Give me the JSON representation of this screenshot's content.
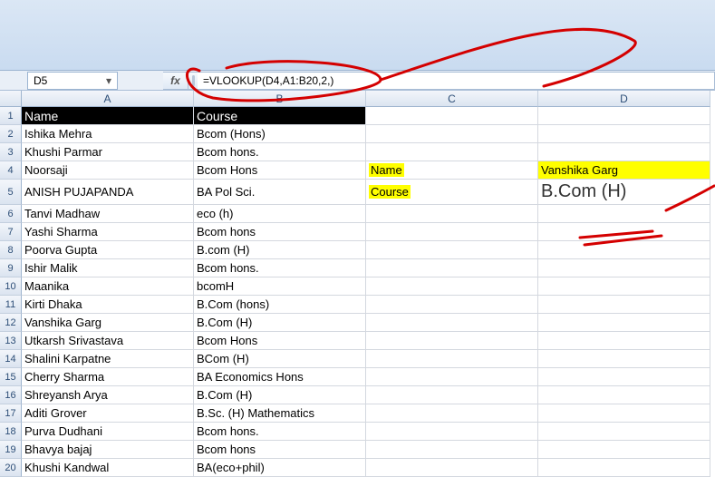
{
  "name_box": "D5",
  "fx_label": "fx",
  "formula": "=VLOOKUP(D4,A1:B20,2,)",
  "col_headers": [
    "A",
    "B",
    "C",
    "D"
  ],
  "row_numbers": [
    "1",
    "2",
    "3",
    "4",
    "5",
    "6",
    "7",
    "8",
    "9",
    "10",
    "11",
    "12",
    "13",
    "14",
    "15",
    "16",
    "17",
    "18",
    "19",
    "20"
  ],
  "header": {
    "a": "Name",
    "b": "Course"
  },
  "side": {
    "name_label": "Name",
    "name_value": "Vanshika Garg",
    "course_label": "Course",
    "course_value": "B.Com (H)"
  },
  "rows": [
    {
      "a": "Ishika Mehra",
      "b": "Bcom (Hons)"
    },
    {
      "a": "Khushi Parmar",
      "b": "Bcom hons."
    },
    {
      "a": "Noorsaji",
      "b": "Bcom Hons"
    },
    {
      "a": "ANISH PUJAPANDA",
      "b": "BA Pol Sci."
    },
    {
      "a": "Tanvi Madhaw",
      "b": "eco (h)"
    },
    {
      "a": "Yashi Sharma",
      "b": "Bcom hons"
    },
    {
      "a": "Poorva Gupta",
      "b": "B.com (H)"
    },
    {
      "a": "Ishir Malik",
      "b": "Bcom hons."
    },
    {
      "a": "Maanika",
      "b": "bcomH"
    },
    {
      "a": "Kirti Dhaka",
      "b": "B.Com (hons)"
    },
    {
      "a": "Vanshika Garg",
      "b": "B.Com (H)"
    },
    {
      "a": "Utkarsh Srivastava",
      "b": "Bcom Hons"
    },
    {
      "a": "Shalini Karpatne",
      "b": "BCom (H)"
    },
    {
      "a": "Cherry Sharma",
      "b": "BA Economics Hons"
    },
    {
      "a": "Shreyansh Arya",
      "b": "B.Com (H)"
    },
    {
      "a": "Aditi Grover",
      "b": "B.Sc. (H) Mathematics"
    },
    {
      "a": "Purva Dudhani",
      "b": "Bcom hons."
    },
    {
      "a": "Bhavya bajaj",
      "b": "Bcom hons"
    },
    {
      "a": "Khushi Kandwal",
      "b": "BA(eco+phil)"
    }
  ],
  "chart_data": {
    "type": "table",
    "columns": [
      "Name",
      "Course"
    ],
    "rows": [
      [
        "Ishika Mehra",
        "Bcom (Hons)"
      ],
      [
        "Khushi Parmar",
        "Bcom hons."
      ],
      [
        "Noorsaji",
        "Bcom Hons"
      ],
      [
        "ANISH PUJAPANDA",
        "BA Pol Sci."
      ],
      [
        "Tanvi Madhaw",
        "eco (h)"
      ],
      [
        "Yashi Sharma",
        "Bcom hons"
      ],
      [
        "Poorva Gupta",
        "B.com (H)"
      ],
      [
        "Ishir Malik",
        "Bcom hons."
      ],
      [
        "Maanika",
        "bcomH"
      ],
      [
        "Kirti Dhaka",
        "B.Com (hons)"
      ],
      [
        "Vanshika Garg",
        "B.Com (H)"
      ],
      [
        "Utkarsh Srivastava",
        "Bcom Hons"
      ],
      [
        "Shalini Karpatne",
        "BCom (H)"
      ],
      [
        "Cherry Sharma",
        "BA Economics Hons"
      ],
      [
        "Shreyansh Arya",
        "B.Com (H)"
      ],
      [
        "Aditi Grover",
        "B.Sc. (H) Mathematics"
      ],
      [
        "Purva Dudhani",
        "Bcom hons."
      ],
      [
        "Bhavya bajaj",
        "Bcom hons"
      ],
      [
        "Khushi Kandwal",
        "BA(eco+phil)"
      ]
    ],
    "lookup": {
      "formula": "=VLOOKUP(D4,A1:B20,2,)",
      "input_name": "Vanshika Garg",
      "result_course": "B.Com (H)"
    }
  }
}
